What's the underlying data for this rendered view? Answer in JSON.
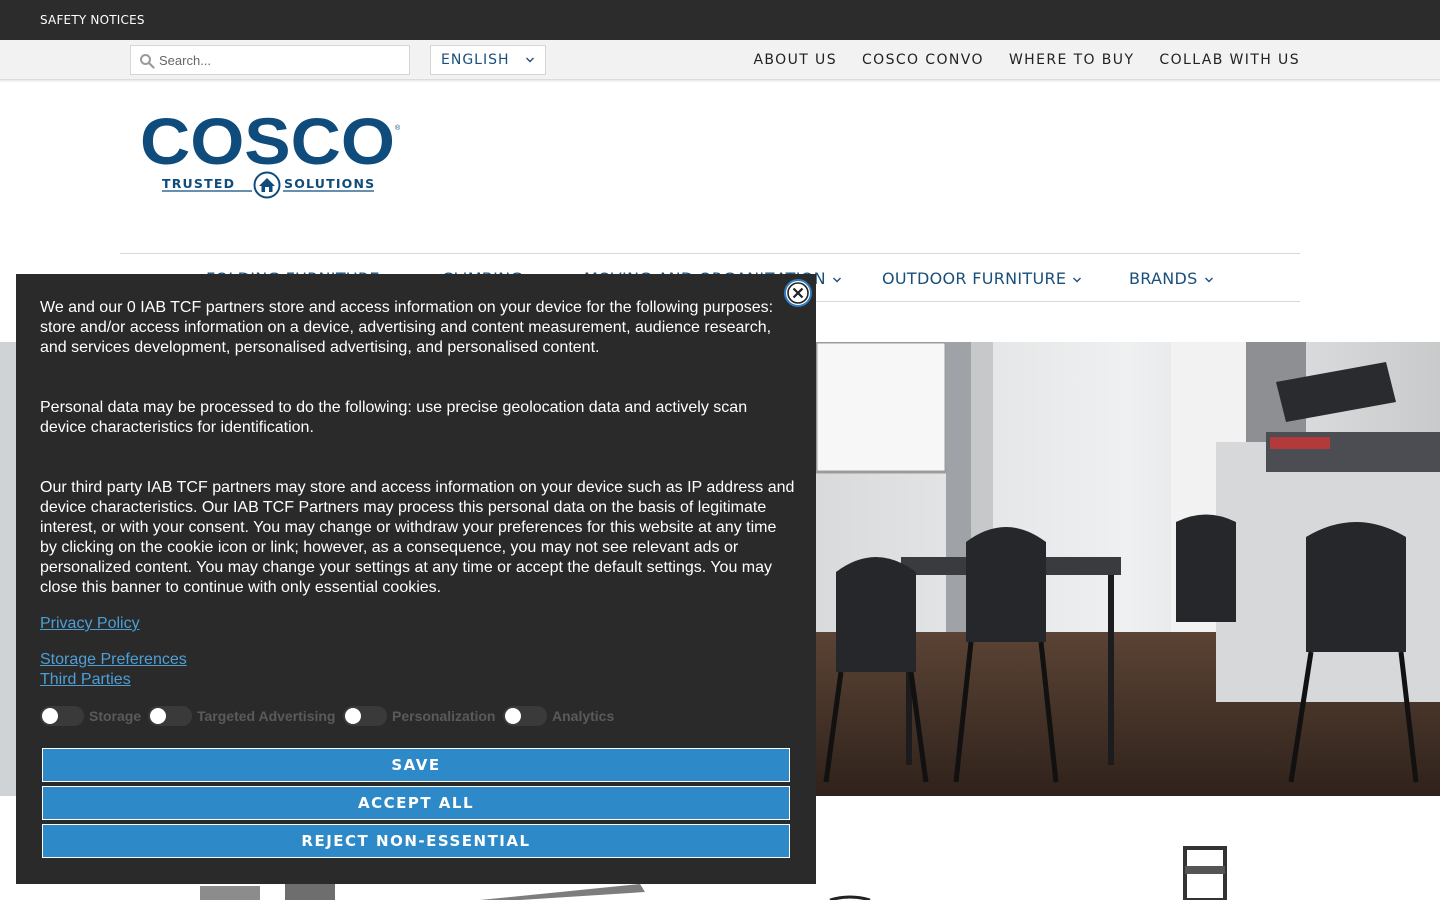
{
  "topbar": {
    "notice": "SAFETY NOTICES"
  },
  "utility": {
    "search_placeholder": "Search...",
    "language": "ENGLISH",
    "links": [
      "ABOUT US",
      "COSCO CONVO",
      "WHERE TO BUY",
      "COLLAB WITH US"
    ]
  },
  "brand": {
    "name": "COSCO",
    "tagline_left": "TRUSTED",
    "tagline_right": "SOLUTIONS",
    "color": "#0f4c7c"
  },
  "nav": {
    "items": [
      "FOLDING FURNITURE",
      "CLIMBING",
      "MOVING AND ORGANIZATION",
      "OUTDOOR FURNITURE",
      "BRANDS"
    ]
  },
  "consent": {
    "paragraph1": "We and our 0 IAB TCF partners store and access information on your device for the following purposes: store and/or access information on a device, advertising and content measurement, audience research, and services development, personalised advertising, and personalised content.",
    "paragraph2": "Personal data may be processed to do the following: use precise geolocation data and actively scan device characteristics for identification.",
    "paragraph3": "Our third party IAB TCF partners may store and access information on your device such as IP address and device characteristics. Our IAB TCF Partners may process this personal data on the basis of legitimate interest, or with your consent. You may change or withdraw your preferences for this website at any time by clicking on the cookie icon or link; however, as a consequence, you may not see relevant ads or personalized content. You may change your settings at any time or accept the default settings. You may close this banner to continue with only essential cookies.",
    "privacy_link": "Privacy Policy",
    "storage_link": "Storage Preferences",
    "third_parties_link": "Third Parties",
    "toggles": [
      {
        "label": "Storage",
        "on": false
      },
      {
        "label": "Targeted Advertising",
        "on": false
      },
      {
        "label": "Personalization",
        "on": false
      },
      {
        "label": "Analytics",
        "on": false
      }
    ],
    "buttons": {
      "save": "SAVE",
      "accept_all": "ACCEPT ALL",
      "reject": "REJECT NON-ESSENTIAL"
    }
  },
  "colors": {
    "accent": "#2e89c8",
    "nav_text": "#1a4f7a",
    "banner_bg": "#2a2a2a",
    "topbar_bg": "#2c2c2c"
  }
}
